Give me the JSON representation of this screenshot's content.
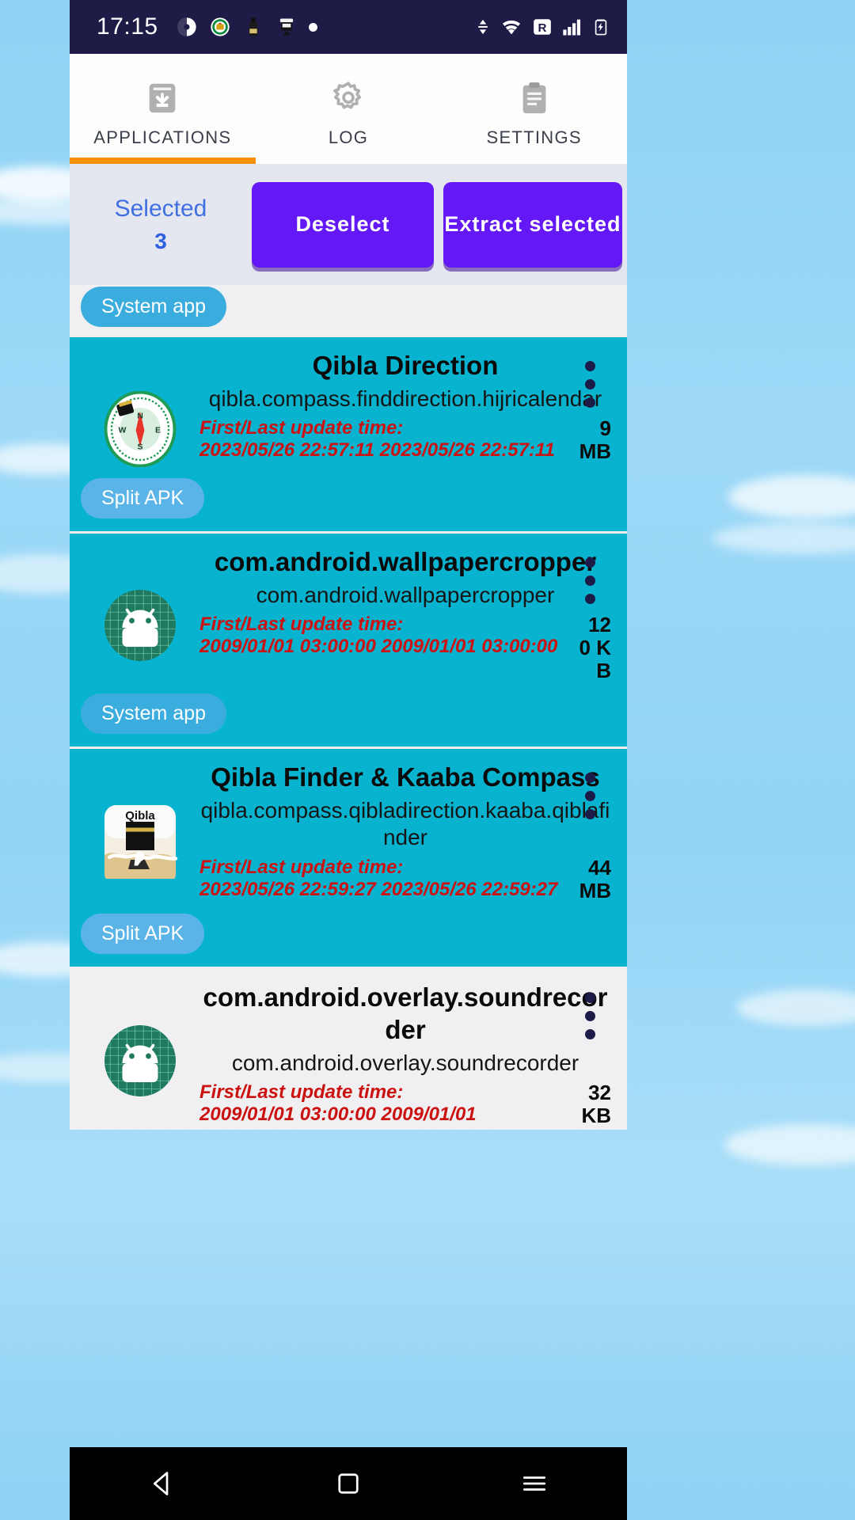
{
  "status_bar": {
    "time": "17:15",
    "left_icons": [
      "app-notification-icon",
      "badge-notification-icon",
      "bottle-notification-icon",
      "train-notification-icon",
      "dot-notification-icon"
    ],
    "right_icons": [
      "data-transfer-icon",
      "wifi-icon",
      "roaming-icon",
      "signal-bars-icon",
      "battery-charging-icon"
    ],
    "roaming_letter": "R",
    "background": "#1e1b47"
  },
  "tabs": [
    {
      "label": "APPLICATIONS",
      "icon": "archive-download-icon",
      "active": true
    },
    {
      "label": "LOG",
      "icon": "gear-icon",
      "active": false
    },
    {
      "label": "SETTINGS",
      "icon": "clipboard-icon",
      "active": false
    }
  ],
  "tab_accent": "#f79009",
  "action_bar": {
    "selected_label": "Selected",
    "selected_count": "3",
    "deselect_label": "Deselect",
    "extract_label": "Extract selected",
    "button_color": "#6318f5",
    "selected_text_color": "#3f6fe0"
  },
  "top_stub": {
    "chip": "System app"
  },
  "apps": [
    {
      "title": "Qibla Direction",
      "package": "qibla.compass.finddirection.hijricalendar",
      "meta_label": "First/Last update time:",
      "times": "2023/05/26 22:57:11   2023/05/26 22:57:11",
      "size": "9 MB",
      "chip": "Split APK",
      "chip_type": "split",
      "icon": "qibla-compass-icon",
      "selected": true
    },
    {
      "title": "com.android.wallpapercropper",
      "package": "com.android.wallpapercropper",
      "meta_label": "First/Last update time:",
      "times": "2009/01/01 03:00:00   2009/01/01 03:00:00",
      "size": "120 KB",
      "chip": "System app",
      "chip_type": "system",
      "icon": "android-robot-icon",
      "selected": true
    },
    {
      "title": "Qibla Finder & Kaaba Compass",
      "package": "qibla.compass.qibladirection.kaaba.qiblafinder",
      "meta_label": "First/Last update time:",
      "times": "2023/05/26 22:59:27   2023/05/26 22:59:27",
      "size": "44 MB",
      "chip": "Split APK",
      "chip_type": "split",
      "icon": "kaaba-qibla-icon",
      "selected": true
    },
    {
      "title": "com.android.overlay.soundrecorder",
      "package": "com.android.overlay.soundrecorder",
      "meta_label": "First/Last update time:",
      "times": "2009/01/01 03:00:00   2009/01/01",
      "size": "32 KB",
      "chip": "",
      "chip_type": "none",
      "icon": "android-robot-icon",
      "selected": false
    }
  ],
  "nav_bar": {
    "back_icon": "back-triangle-icon",
    "home_icon": "home-square-icon",
    "recents_icon": "recents-menu-icon"
  },
  "colors": {
    "card_selected": "#08b3d0",
    "card_unselected": "#f0f0f2",
    "meta_red": "#cc1111"
  }
}
